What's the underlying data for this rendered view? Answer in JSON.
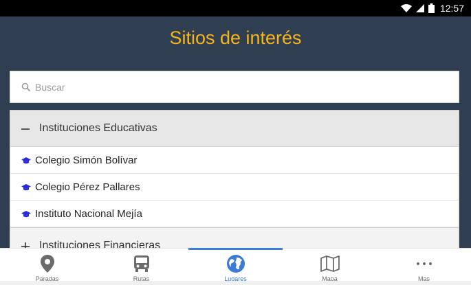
{
  "status_bar": {
    "time": "12:57",
    "icons": [
      "wifi-icon",
      "signal-icon",
      "battery-icon"
    ]
  },
  "header": {
    "title": "Sitios de interés"
  },
  "search": {
    "placeholder": "Buscar",
    "value": ""
  },
  "groups": [
    {
      "label": "Instituciones Educativas",
      "expanded": true,
      "items": [
        {
          "label": "Colegio Simón Bolívar",
          "icon": "graduation-cap-icon"
        },
        {
          "label": "Colegio Pérez Pallares",
          "icon": "graduation-cap-icon"
        },
        {
          "label": "Instituto Nacional Mejía",
          "icon": "graduation-cap-icon"
        }
      ]
    },
    {
      "label": "Instituciones Financieras",
      "expanded": false,
      "items": []
    }
  ],
  "bottom_nav": {
    "items": [
      {
        "label": "Paradas",
        "icon": "map-pin-icon",
        "active": false
      },
      {
        "label": "Rutas",
        "icon": "bus-icon",
        "active": false
      },
      {
        "label": "Lugares",
        "icon": "globe-icon",
        "active": true
      },
      {
        "label": "Mapa",
        "icon": "map-icon",
        "active": false
      },
      {
        "label": "Mas",
        "icon": "more-icon",
        "active": false
      }
    ]
  },
  "colors": {
    "header_bg": "#2f3e50",
    "title": "#f5b51b",
    "accent": "#3a7bd5",
    "cap_icon": "#2a2ad6"
  }
}
